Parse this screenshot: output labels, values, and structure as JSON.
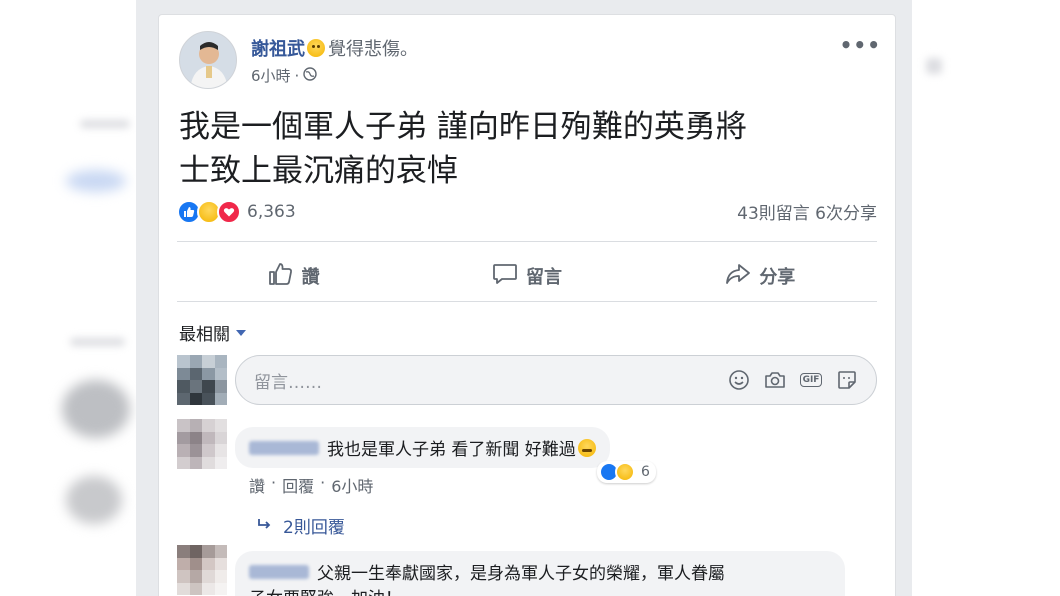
{
  "post": {
    "author": "謝祖武",
    "feeling": "覺得悲傷。",
    "time": "6小時",
    "text_line1": "我是一個軍人子弟 謹向昨日殉難的英勇將",
    "text_line2": "士致上最沉痛的哀悼",
    "reaction_count": "6,363",
    "comments_shares": "43則留言 6次分享"
  },
  "actions": {
    "like": "讚",
    "comment": "留言",
    "share": "分享"
  },
  "comments_section": {
    "sort_label": "最相關",
    "input_placeholder": "留言……",
    "input_icons": [
      "smiley-icon",
      "camera-icon",
      "gif-icon",
      "sticker-icon"
    ],
    "gif_label": "GIF"
  },
  "comments": [
    {
      "text": "我也是軍人子弟 看了新聞 好難過",
      "like_label": "讚",
      "reply_label": "回覆",
      "time": "6小時",
      "reaction_count": "6",
      "replies_label": "2則回覆"
    },
    {
      "text_line1": "父親一生奉獻國家，是身為軍人子女的榮耀，軍人眷屬",
      "text_line2": "子女要堅強，加油！"
    }
  ],
  "colors": {
    "link_blue": "#365899",
    "like_blue": "#1877f2",
    "love_red": "#f0284a",
    "page_bg": "#e9ebee"
  }
}
